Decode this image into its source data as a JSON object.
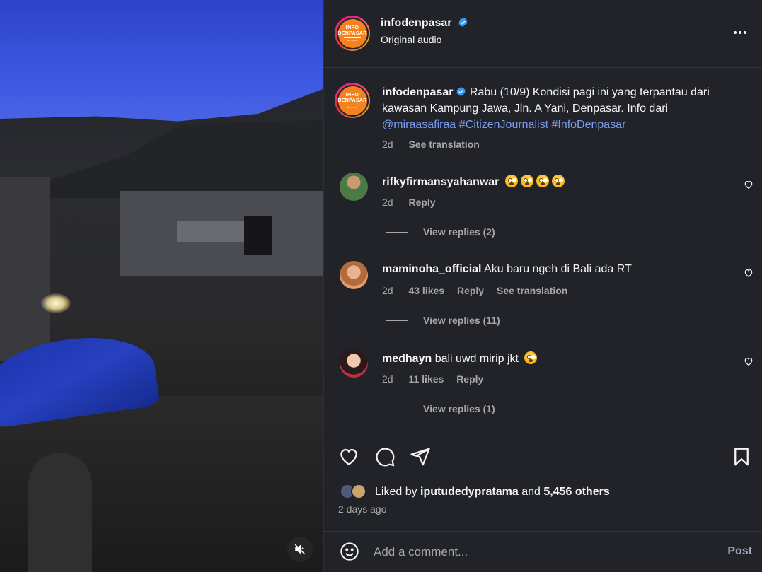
{
  "post": {
    "author": "infodenpasar",
    "audio": "Original audio",
    "logo_line1": "INFO",
    "logo_line2": "DENPASAR",
    "logo_line3": "EST. 2016",
    "caption": {
      "username": "infodenpasar",
      "text": "Rabu (10/9) Kondisi pagi ini yang terpantau dari kawasan Kampung Jawa, Jln. A Yani, Denpasar. Info dari",
      "mention": "@miraasafiraa",
      "hashtag1": "#CitizenJournalist",
      "hashtag2": "#InfoDenpasar",
      "time": "2d",
      "see_translation": "See translation"
    }
  },
  "comments": [
    {
      "username": "rifkyfirmansyahanwar",
      "text": "",
      "time": "2d",
      "likes": "",
      "reply": "Reply",
      "view_replies": "View replies (2)"
    },
    {
      "username": "maminoha_official",
      "text": "Aku baru ngeh di Bali ada RT",
      "time": "2d",
      "likes": "43 likes",
      "reply": "Reply",
      "see_translation": "See translation",
      "view_replies": "View replies (11)"
    },
    {
      "username": "medhayn",
      "text": "bali uwd mirip jkt",
      "time": "2d",
      "likes": "11 likes",
      "reply": "Reply",
      "view_replies": "View replies (1)"
    }
  ],
  "likes": {
    "prefix": "Liked by",
    "user": "iputudedypratama",
    "and": "and",
    "others": "5,456 others",
    "posted_ago": "2 days ago"
  },
  "add_comment": {
    "placeholder": "Add a comment...",
    "post_label": "Post"
  },
  "colors": {
    "panel_bg": "#212328",
    "link": "#7a9cf0",
    "secondary_text": "#a8a8a8",
    "verified": "#3897f0",
    "brand_orange": "#f58220"
  },
  "icons": [
    "mute-icon",
    "more-options-icon",
    "verified-badge-icon",
    "heart-icon",
    "comment-icon",
    "share-icon",
    "bookmark-icon",
    "emoji-icon"
  ]
}
